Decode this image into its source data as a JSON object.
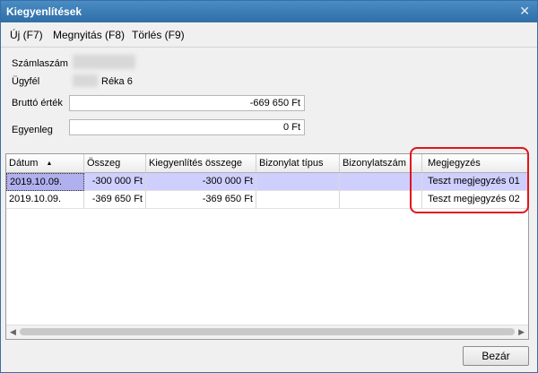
{
  "window": {
    "title": "Kiegyenlítések",
    "close_glyph": "✕"
  },
  "menu": [
    {
      "label": "Új (F7)"
    },
    {
      "label": "Megnyitás (F8)"
    },
    {
      "label": "Törlés (F9)"
    }
  ],
  "form": {
    "account_label": "Számlaszám",
    "customer_label": "Ügyfél",
    "customer_name_suffix": "Réka 6",
    "gross_label": "Bruttó érték",
    "gross_value": "-669 650 Ft",
    "balance_label": "Egyenleg",
    "balance_value": "0 Ft"
  },
  "grid": {
    "columns": [
      "Dátum",
      "Összeg",
      "Kiegyenlítés összege",
      "Bizonylat típus",
      "Bizonylatszám",
      "Megjegyzés"
    ],
    "sort_indicator": "▲",
    "rows": [
      {
        "date": "2019.10.09.",
        "amount": "-300 000 Ft",
        "settled": "-300 000 Ft",
        "doc_type": "",
        "doc_no": "",
        "note": "Teszt megjegyzés 01",
        "selected": true
      },
      {
        "date": "2019.10.09.",
        "amount": "-369 650 Ft",
        "settled": "-369 650 Ft",
        "doc_type": "",
        "doc_no": "",
        "note": "Teszt megjegyzés 02",
        "selected": false
      }
    ]
  },
  "buttons": {
    "close_label": "Bezár"
  },
  "colors": {
    "titlebar": "#2f6ea6",
    "selected_row": "#cfcfff",
    "highlight": "#e3141b"
  }
}
